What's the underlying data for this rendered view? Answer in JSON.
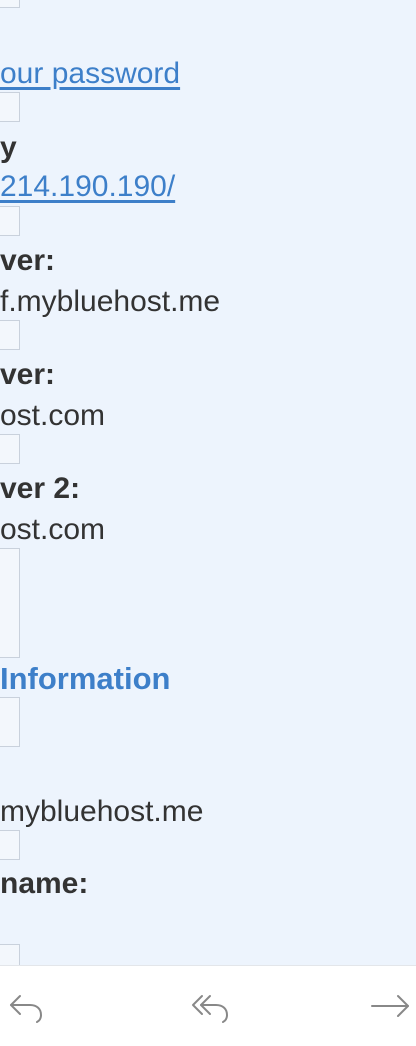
{
  "content": {
    "password_link": "our password",
    "label_y": "y",
    "ip_link": "214.190.190/",
    "server1_label": "ver:",
    "server1_value": "f.mybluehost.me",
    "server2_label": "ver:",
    "server2_value": "ost.com",
    "server3_label": "ver 2:",
    "server3_value": "ost.com",
    "section_heading": "Information",
    "domain_value": "mybluehost.me",
    "username_label": "name:"
  },
  "toolbar": {
    "buttons": [
      "reply-icon",
      "reply-all-icon",
      "forward-icon"
    ]
  },
  "colors": {
    "background": "#edf4fd",
    "link": "#3d7fc9",
    "text": "#333333",
    "toolbar_bg": "#ffffff"
  }
}
